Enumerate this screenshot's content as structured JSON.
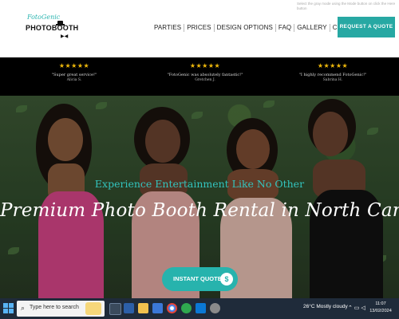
{
  "header": {
    "logo_script": "FotoGenic",
    "logo_main": "PHOTOBOOTH",
    "nav": [
      "PARTIES",
      "PRICES",
      "DESIGN OPTIONS",
      "FAQ",
      "GALLERY",
      "CONTACT"
    ],
    "request_quote_label": "REQUEST A QUOTE",
    "hint_text": "Select the gray mode using the Mode button on click the Here button"
  },
  "testimonials": [
    {
      "stars": "★★★★★",
      "quote": "\"Super great service!\"",
      "author": "Alicia S."
    },
    {
      "stars": "★★★★★",
      "quote": "\"FotoGenic was absolutely fantastic!\"",
      "author": "Gretchen J."
    },
    {
      "stars": "★★★★★",
      "quote": "\"I highly recommend FotoGenic!\"",
      "author": "Sabrina H."
    }
  ],
  "hero": {
    "subtitle": "Experience Entertainment Like No Other",
    "title": "Premium Photo Booth Rental in North Carolina",
    "cta_label": "INSTANT QUOTE",
    "cta_icon": "$"
  },
  "taskbar": {
    "search_placeholder": "Type here to search",
    "weather": "26°C  Mostly cloudy",
    "time": "11:07",
    "date": "13/02/2024"
  },
  "colors": {
    "accent": "#27a8a3",
    "hero_subtitle": "#33c4be",
    "star": "#f0b90b",
    "taskbar": "#1f2b3a"
  },
  "icons": {
    "start": "windows-start-icon",
    "search": "search-icon",
    "cta": "dollar-icon"
  }
}
